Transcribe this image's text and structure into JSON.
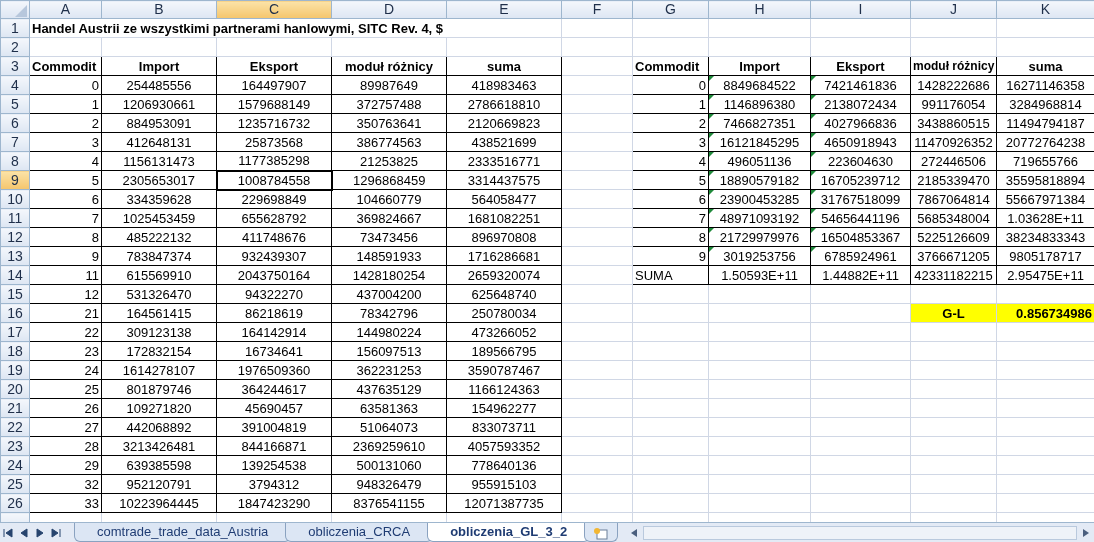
{
  "sheet": {
    "columns": [
      {
        "label": "A",
        "selected": false
      },
      {
        "label": "B",
        "selected": false
      },
      {
        "label": "C",
        "selected": true
      },
      {
        "label": "D",
        "selected": false
      },
      {
        "label": "E",
        "selected": false
      },
      {
        "label": "F",
        "selected": false
      },
      {
        "label": "G",
        "selected": false
      },
      {
        "label": "H",
        "selected": false
      },
      {
        "label": "I",
        "selected": false
      },
      {
        "label": "J",
        "selected": false
      },
      {
        "label": "K",
        "selected": false
      }
    ],
    "rows": [
      {
        "label": "1",
        "selected": false
      },
      {
        "label": "2",
        "selected": false
      },
      {
        "label": "3",
        "selected": false
      },
      {
        "label": "4",
        "selected": false
      },
      {
        "label": "5",
        "selected": false
      },
      {
        "label": "6",
        "selected": false
      },
      {
        "label": "7",
        "selected": false
      },
      {
        "label": "8",
        "selected": false
      },
      {
        "label": "9",
        "selected": true
      },
      {
        "label": "10",
        "selected": false
      },
      {
        "label": "11",
        "selected": false
      },
      {
        "label": "12",
        "selected": false
      },
      {
        "label": "13",
        "selected": false
      },
      {
        "label": "14",
        "selected": false
      },
      {
        "label": "15",
        "selected": false
      },
      {
        "label": "16",
        "selected": false
      },
      {
        "label": "17",
        "selected": false
      },
      {
        "label": "18",
        "selected": false
      },
      {
        "label": "19",
        "selected": false
      },
      {
        "label": "20",
        "selected": false
      },
      {
        "label": "21",
        "selected": false
      },
      {
        "label": "22",
        "selected": false
      },
      {
        "label": "23",
        "selected": false
      },
      {
        "label": "24",
        "selected": false
      },
      {
        "label": "25",
        "selected": false
      },
      {
        "label": "26",
        "selected": false
      }
    ]
  },
  "title": "Handel Austrii ze wszystkimi partnerami hanlowymi, SITC Rev. 4, $",
  "left_table": {
    "columns": [
      "Commodit",
      "Import",
      "Eksport",
      "moduł różnicy",
      "suma"
    ],
    "rows": [
      [
        "0",
        "254485556",
        "164497907",
        "89987649",
        "418983463"
      ],
      [
        "1",
        "1206930661",
        "1579688149",
        "372757488",
        "2786618810"
      ],
      [
        "2",
        "884953091",
        "1235716732",
        "350763641",
        "2120669823"
      ],
      [
        "3",
        "412648131",
        "25873568",
        "386774563",
        "438521699"
      ],
      [
        "4",
        "1156131473",
        "1177385298",
        "21253825",
        "2333516771"
      ],
      [
        "5",
        "2305653017",
        "1008784558",
        "1296868459",
        "3314437575"
      ],
      [
        "6",
        "334359628",
        "229698849",
        "104660779",
        "564058477"
      ],
      [
        "7",
        "1025453459",
        "655628792",
        "369824667",
        "1681082251"
      ],
      [
        "8",
        "485222132",
        "411748676",
        "73473456",
        "896970808"
      ],
      [
        "9",
        "783847374",
        "932439307",
        "148591933",
        "1716286681"
      ],
      [
        "11",
        "615569910",
        "2043750164",
        "1428180254",
        "2659320074"
      ],
      [
        "12",
        "531326470",
        "94322270",
        "437004200",
        "625648740"
      ],
      [
        "21",
        "164561415",
        "86218619",
        "78342796",
        "250780034"
      ],
      [
        "22",
        "309123138",
        "164142914",
        "144980224",
        "473266052"
      ],
      [
        "23",
        "172832154",
        "16734641",
        "156097513",
        "189566795"
      ],
      [
        "24",
        "1614278107",
        "1976509360",
        "362231253",
        "3590787467"
      ],
      [
        "25",
        "801879746",
        "364244617",
        "437635129",
        "1166124363"
      ],
      [
        "26",
        "109271820",
        "45690457",
        "63581363",
        "154962277"
      ],
      [
        "27",
        "442068892",
        "391004819",
        "51064073",
        "833073711"
      ],
      [
        "28",
        "3213426481",
        "844166871",
        "2369259610",
        "4057593352"
      ],
      [
        "29",
        "639385598",
        "139254538",
        "500131060",
        "778640136"
      ],
      [
        "32",
        "952120791",
        "3794312",
        "948326479",
        "955915103"
      ],
      [
        "33",
        "10223964445",
        "1847423290",
        "8376541155",
        "12071387735"
      ]
    ]
  },
  "right_table": {
    "columns": [
      "Commodit",
      "Import",
      "Eksport",
      "moduł różnicy",
      "suma"
    ],
    "rows": [
      {
        "kind": "data",
        "flagged": true,
        "cells": [
          "0",
          "8849684522",
          "7421461836",
          "1428222686",
          "16271146358"
        ]
      },
      {
        "kind": "data",
        "flagged": true,
        "cells": [
          "1",
          "1146896380",
          "2138072434",
          "991176054",
          "3284968814"
        ]
      },
      {
        "kind": "data",
        "flagged": true,
        "cells": [
          "2",
          "7466827351",
          "4027966836",
          "3438860515",
          "11494794187"
        ]
      },
      {
        "kind": "data",
        "flagged": true,
        "cells": [
          "3",
          "16121845295",
          "4650918943",
          "11470926352",
          "20772764238"
        ]
      },
      {
        "kind": "data",
        "flagged": true,
        "cells": [
          "4",
          "496051136",
          "223604630",
          "272446506",
          "719655766"
        ]
      },
      {
        "kind": "data",
        "flagged": true,
        "cells": [
          "5",
          "18890579182",
          "16705239712",
          "2185339470",
          "35595818894"
        ]
      },
      {
        "kind": "data",
        "flagged": true,
        "cells": [
          "6",
          "23900453285",
          "31767518099",
          "7867064814",
          "55667971384"
        ]
      },
      {
        "kind": "data",
        "flagged": true,
        "cells": [
          "7",
          "48971093192",
          "54656441196",
          "5685348004",
          "1.03628E+11"
        ]
      },
      {
        "kind": "data",
        "flagged": true,
        "cells": [
          "8",
          "21729979976",
          "16504853367",
          "5225126609",
          "38234833343"
        ]
      },
      {
        "kind": "data",
        "flagged": true,
        "cells": [
          "9",
          "3019253756",
          "6785924961",
          "3766671205",
          "9805178717"
        ]
      },
      {
        "kind": "total",
        "flagged": false,
        "cells": [
          "SUMA",
          "1.50593E+11",
          "1.44882E+11",
          "42331182215",
          "2.95475E+11"
        ]
      }
    ]
  },
  "result": {
    "label": "G-L",
    "value": "0.856734986"
  },
  "sheet_tabs": [
    {
      "label": "comtrade_trade_data_Austria",
      "selected": false
    },
    {
      "label": "obliczenia_CRCA",
      "selected": false
    },
    {
      "label": "obliczenia_GL_3_2",
      "selected": true
    }
  ]
}
